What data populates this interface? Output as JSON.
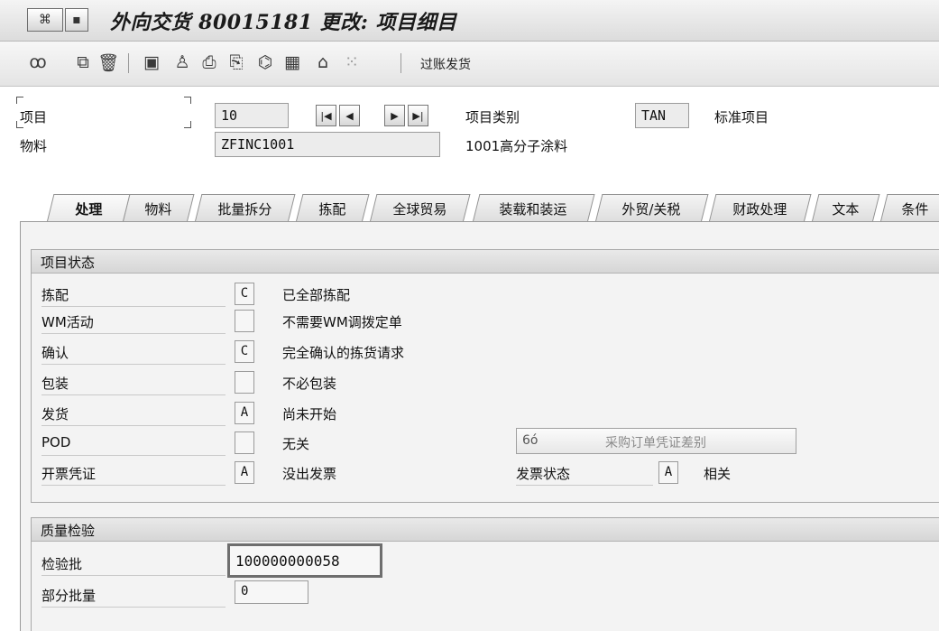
{
  "window": {
    "title": "外向交货 80015181 更改: 项目细目"
  },
  "toolbar": {
    "post_goods_issue": "过账发货",
    "icons": [
      "glasses-icon",
      "copy-icon",
      "trash-icon",
      "display-icon",
      "users-icon",
      "print-icon",
      "print-preview-icon",
      "batch-icon",
      "grid-icon",
      "house-icon",
      "dots-grid-icon"
    ]
  },
  "header": {
    "item_label": "项目",
    "item_value": "10",
    "material_label": "物料",
    "material_value": "ZFINC1001",
    "item_category_label": "项目类别",
    "item_category_value": "TAN",
    "item_category_desc": "标准项目",
    "material_desc": "1001高分子涂料"
  },
  "tabs": [
    {
      "label": "处理",
      "active": true
    },
    {
      "label": "物料"
    },
    {
      "label": "批量拆分"
    },
    {
      "label": "拣配"
    },
    {
      "label": "全球贸易"
    },
    {
      "label": "装载和装运"
    },
    {
      "label": "外贸/关税"
    },
    {
      "label": "财政处理"
    },
    {
      "label": "文本"
    },
    {
      "label": "条件"
    }
  ],
  "item_status": {
    "title": "项目状态",
    "rows": [
      {
        "label": "拣配",
        "code": "C",
        "desc": "已全部拣配"
      },
      {
        "label": "WM活动",
        "code": "",
        "desc": "不需要WM调拨定单"
      },
      {
        "label": "确认",
        "code": "C",
        "desc": "完全确认的拣货请求"
      },
      {
        "label": "包装",
        "code": "",
        "desc": "不必包装"
      },
      {
        "label": "发货",
        "code": "A",
        "desc": "尚未开始"
      },
      {
        "label": "POD",
        "code": "",
        "desc": "无关"
      },
      {
        "label": "开票凭证",
        "code": "A",
        "desc": "没出发票"
      }
    ],
    "po_diff_button": "采购订单凭证差别",
    "billing_status_label": "发票状态",
    "billing_status_code": "A",
    "billing_status_desc": "相关"
  },
  "quality": {
    "title": "质量检验",
    "lot_label": "检验批",
    "lot_value": "100000000058",
    "partial_label": "部分批量",
    "partial_value": "0"
  }
}
